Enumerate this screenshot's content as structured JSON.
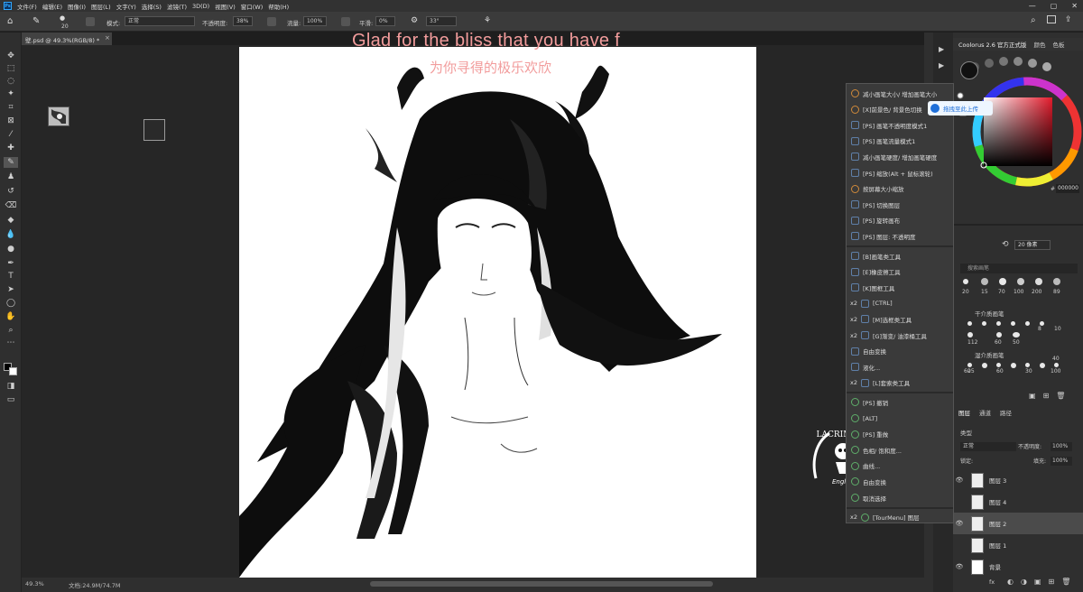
{
  "menubar": {
    "app_icon": "Ps",
    "items": [
      "文件(F)",
      "编辑(E)",
      "图像(I)",
      "图层(L)",
      "文字(Y)",
      "选择(S)",
      "滤镜(T)",
      "3D(D)",
      "视图(V)",
      "窗口(W)",
      "帮助(H)"
    ],
    "window_controls": [
      "—",
      "▢",
      "✕"
    ]
  },
  "options": {
    "brush_size": "20",
    "mode_label": "模式:",
    "mode_value": "正常",
    "opacity_label": "不透明度:",
    "opacity_value": "38%",
    "flow_label": "流量:",
    "flow_value": "100%",
    "smooth_label": "平滑:",
    "smooth_value": "0%",
    "angle_value": "33°"
  },
  "document": {
    "tab_title": "壁.psd @ 49.3%(RGB/8) *",
    "overlay_en": "Glad for the bliss that you have f",
    "overlay_cn": "为你寻得的极乐欢欣",
    "watermark_sub": "English"
  },
  "status": {
    "zoom": "49.3%",
    "doc_size": "文档:24.9M/74.7M"
  },
  "coolorus": {
    "tab_title": "Coolorus 2.6 官方正式版",
    "tab2": "颜色",
    "tab3": "色板",
    "hex_label": "#",
    "hex_value": "000000",
    "accent": "#f04040"
  },
  "tourmenu": {
    "items": [
      {
        "label": "减小画笔大小/ 增加画笔大小",
        "icon": "orange"
      },
      {
        "label": "[X]前景色/ 背景色切换",
        "icon": "orange"
      },
      {
        "label": "[PS] 画笔不透明度模式1",
        "icon": "blue"
      },
      {
        "label": "[PS] 画笔流量模式1",
        "icon": "blue"
      },
      {
        "label": "减小画笔硬度/ 增加画笔硬度",
        "icon": "blue"
      },
      {
        "label": "[PS] 缩放(Alt + 鼠标滚轮)",
        "icon": "blue"
      },
      {
        "label": "按屏幕大小缩放",
        "icon": "orange"
      },
      {
        "label": "[PS] 切换图层",
        "icon": "blue"
      },
      {
        "label": "[PS] 旋转画布",
        "icon": "blue"
      },
      {
        "label": "[PS] 图层: 不透明度",
        "icon": "blue"
      },
      {
        "label": "[B]画笔类工具",
        "icon": "blue",
        "x2": ""
      },
      {
        "label": "[E]橡皮擦工具",
        "icon": "blue",
        "x2": ""
      },
      {
        "label": "[K]图框工具",
        "icon": "blue",
        "x2": ""
      },
      {
        "label": "[CTRL]",
        "icon": "blue",
        "x2": "x2"
      },
      {
        "label": "[M]选框类工具",
        "icon": "blue",
        "x2": "x2"
      },
      {
        "label": "[G]渐变/ 油漆桶工具",
        "icon": "blue",
        "x2": "x2"
      },
      {
        "label": "自由变换",
        "icon": "blue",
        "x2": ""
      },
      {
        "label": "液化...",
        "icon": "blue",
        "x2": ""
      },
      {
        "label": "[L]套索类工具",
        "icon": "blue",
        "x2": "x2"
      },
      {
        "label": "[PS] 撤销",
        "icon": "green",
        "x2": ""
      },
      {
        "label": "[ALT]",
        "icon": "green",
        "x2": ""
      },
      {
        "label": "[PS] 重做",
        "icon": "green",
        "x2": ""
      },
      {
        "label": "色相/ 饱和度...",
        "icon": "green",
        "x2": ""
      },
      {
        "label": "曲线...",
        "icon": "green",
        "x2": ""
      },
      {
        "label": "自由变换",
        "icon": "green",
        "x2": ""
      },
      {
        "label": "取消选择",
        "icon": "green",
        "x2": ""
      },
      {
        "label": "[TourMenu] 图层",
        "icon": "green",
        "x2": "x2"
      }
    ]
  },
  "tooltip": {
    "label": "拖拽至此上传"
  },
  "brushes": {
    "size_value": "20 像素",
    "search_placeholder": "搜索画笔",
    "row_labels": [
      "20",
      "15",
      "70",
      "100",
      "200",
      "89"
    ],
    "group1": "干介质画笔",
    "group1_labels": [
      "112",
      "60",
      "50"
    ],
    "group1_top": [
      "8",
      "10"
    ],
    "group2": "湿介质画笔",
    "group2_labels": [
      "25",
      "60",
      "30",
      "100"
    ],
    "group2_top": [
      "60",
      "40"
    ]
  },
  "layers": {
    "tabs": [
      "图层",
      "通道",
      "路径"
    ],
    "kind_label": "类型",
    "blend": "正常",
    "opacity_label": "不透明度:",
    "opacity_value": "100%",
    "lock_label": "锁定:",
    "fill_label": "填充:",
    "fill_value": "100%",
    "items": [
      "图层 3",
      "图层 4",
      "图层 2",
      "图层 1",
      "背景"
    ],
    "footer": "fx"
  }
}
